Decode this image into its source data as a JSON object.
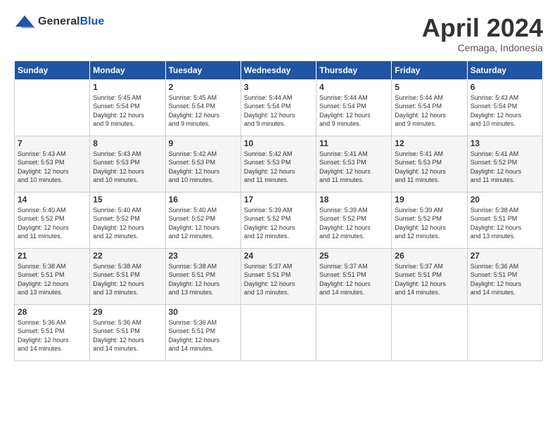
{
  "logo": {
    "general": "General",
    "blue": "Blue"
  },
  "header": {
    "month": "April 2024",
    "location": "Cemaga, Indonesia"
  },
  "weekdays": [
    "Sunday",
    "Monday",
    "Tuesday",
    "Wednesday",
    "Thursday",
    "Friday",
    "Saturday"
  ],
  "weeks": [
    [
      {
        "day": null,
        "info": null
      },
      {
        "day": "1",
        "info": "Sunrise: 5:45 AM\nSunset: 5:54 PM\nDaylight: 12 hours\nand 9 minutes."
      },
      {
        "day": "2",
        "info": "Sunrise: 5:45 AM\nSunset: 5:54 PM\nDaylight: 12 hours\nand 9 minutes."
      },
      {
        "day": "3",
        "info": "Sunrise: 5:44 AM\nSunset: 5:54 PM\nDaylight: 12 hours\nand 9 minutes."
      },
      {
        "day": "4",
        "info": "Sunrise: 5:44 AM\nSunset: 5:54 PM\nDaylight: 12 hours\nand 9 minutes."
      },
      {
        "day": "5",
        "info": "Sunrise: 5:44 AM\nSunset: 5:54 PM\nDaylight: 12 hours\nand 9 minutes."
      },
      {
        "day": "6",
        "info": "Sunrise: 5:43 AM\nSunset: 5:54 PM\nDaylight: 12 hours\nand 10 minutes."
      }
    ],
    [
      {
        "day": "7",
        "info": "Sunrise: 5:43 AM\nSunset: 5:53 PM\nDaylight: 12 hours\nand 10 minutes."
      },
      {
        "day": "8",
        "info": "Sunrise: 5:43 AM\nSunset: 5:53 PM\nDaylight: 12 hours\nand 10 minutes."
      },
      {
        "day": "9",
        "info": "Sunrise: 5:42 AM\nSunset: 5:53 PM\nDaylight: 12 hours\nand 10 minutes."
      },
      {
        "day": "10",
        "info": "Sunrise: 5:42 AM\nSunset: 5:53 PM\nDaylight: 12 hours\nand 11 minutes."
      },
      {
        "day": "11",
        "info": "Sunrise: 5:41 AM\nSunset: 5:53 PM\nDaylight: 12 hours\nand 11 minutes."
      },
      {
        "day": "12",
        "info": "Sunrise: 5:41 AM\nSunset: 5:53 PM\nDaylight: 12 hours\nand 11 minutes."
      },
      {
        "day": "13",
        "info": "Sunrise: 5:41 AM\nSunset: 5:52 PM\nDaylight: 12 hours\nand 11 minutes."
      }
    ],
    [
      {
        "day": "14",
        "info": "Sunrise: 5:40 AM\nSunset: 5:52 PM\nDaylight: 12 hours\nand 11 minutes."
      },
      {
        "day": "15",
        "info": "Sunrise: 5:40 AM\nSunset: 5:52 PM\nDaylight: 12 hours\nand 12 minutes."
      },
      {
        "day": "16",
        "info": "Sunrise: 5:40 AM\nSunset: 5:52 PM\nDaylight: 12 hours\nand 12 minutes."
      },
      {
        "day": "17",
        "info": "Sunrise: 5:39 AM\nSunset: 5:52 PM\nDaylight: 12 hours\nand 12 minutes."
      },
      {
        "day": "18",
        "info": "Sunrise: 5:39 AM\nSunset: 5:52 PM\nDaylight: 12 hours\nand 12 minutes."
      },
      {
        "day": "19",
        "info": "Sunrise: 5:39 AM\nSunset: 5:52 PM\nDaylight: 12 hours\nand 12 minutes."
      },
      {
        "day": "20",
        "info": "Sunrise: 5:38 AM\nSunset: 5:51 PM\nDaylight: 12 hours\nand 13 minutes."
      }
    ],
    [
      {
        "day": "21",
        "info": "Sunrise: 5:38 AM\nSunset: 5:51 PM\nDaylight: 12 hours\nand 13 minutes."
      },
      {
        "day": "22",
        "info": "Sunrise: 5:38 AM\nSunset: 5:51 PM\nDaylight: 12 hours\nand 13 minutes."
      },
      {
        "day": "23",
        "info": "Sunrise: 5:38 AM\nSunset: 5:51 PM\nDaylight: 12 hours\nand 13 minutes."
      },
      {
        "day": "24",
        "info": "Sunrise: 5:37 AM\nSunset: 5:51 PM\nDaylight: 12 hours\nand 13 minutes."
      },
      {
        "day": "25",
        "info": "Sunrise: 5:37 AM\nSunset: 5:51 PM\nDaylight: 12 hours\nand 14 minutes."
      },
      {
        "day": "26",
        "info": "Sunrise: 5:37 AM\nSunset: 5:51 PM\nDaylight: 12 hours\nand 14 minutes."
      },
      {
        "day": "27",
        "info": "Sunrise: 5:36 AM\nSunset: 5:51 PM\nDaylight: 12 hours\nand 14 minutes."
      }
    ],
    [
      {
        "day": "28",
        "info": "Sunrise: 5:36 AM\nSunset: 5:51 PM\nDaylight: 12 hours\nand 14 minutes."
      },
      {
        "day": "29",
        "info": "Sunrise: 5:36 AM\nSunset: 5:51 PM\nDaylight: 12 hours\nand 14 minutes."
      },
      {
        "day": "30",
        "info": "Sunrise: 5:36 AM\nSunset: 5:51 PM\nDaylight: 12 hours\nand 14 minutes."
      },
      {
        "day": null,
        "info": null
      },
      {
        "day": null,
        "info": null
      },
      {
        "day": null,
        "info": null
      },
      {
        "day": null,
        "info": null
      }
    ]
  ]
}
